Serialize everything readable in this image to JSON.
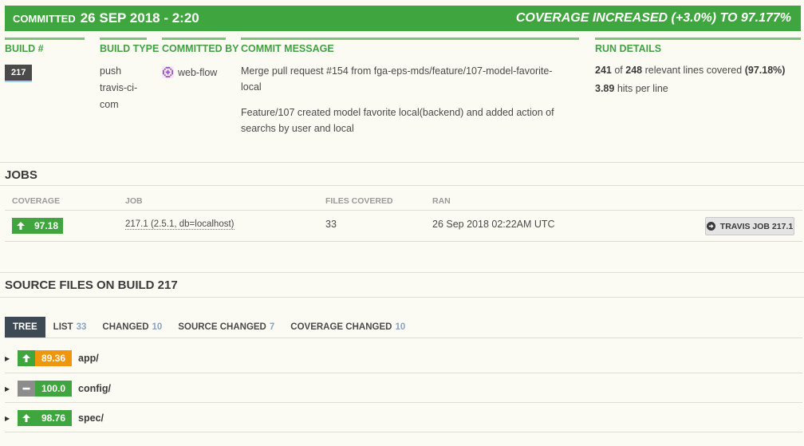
{
  "banner": {
    "committed_label": "Committed",
    "committed_date": "26 SEP 2018 - 2:20",
    "coverage_status": "COVERAGE INCREASED (+3.0%) TO 97.177%"
  },
  "info": {
    "build": {
      "heading": "BUILD #",
      "value": "217"
    },
    "build_type": {
      "heading": "BUILD TYPE",
      "lines": [
        "push",
        "travis-ci-",
        "com"
      ]
    },
    "committed_by": {
      "heading": "COMMITTED BY",
      "user": "web-flow"
    },
    "commit_message": {
      "heading": "COMMIT MESSAGE",
      "paragraph1": "Merge pull request #154 from fga-eps-mds/feature/107-model-favorite-local",
      "paragraph2": "Feature/107 created model favorite local(backend) and added action of searchs by user and local"
    },
    "run_details": {
      "heading": "RUN DETAILS",
      "covered": "241",
      "of": "of",
      "relevant": "248",
      "relevant_text": "relevant lines covered",
      "percent": "(97.18%)",
      "hits": "3.89",
      "hits_text": "hits per line"
    }
  },
  "jobs": {
    "title": "JOBS",
    "headers": {
      "coverage": "Coverage",
      "job": "Job",
      "files_covered": "Files Covered",
      "ran": "Ran"
    },
    "rows": [
      {
        "coverage": "97.18",
        "job": "217.1 (2.5.1, db=localhost)",
        "files_covered": "33",
        "ran": "26 Sep 2018 02:22AM UTC",
        "button": "TRAVIS JOB 217.1"
      }
    ]
  },
  "source_files": {
    "title": "SOURCE FILES ON BUILD 217",
    "tabs": [
      {
        "label": "TREE",
        "count": ""
      },
      {
        "label": "LIST",
        "count": "33"
      },
      {
        "label": "CHANGED",
        "count": "10"
      },
      {
        "label": "SOURCE CHANGED",
        "count": "7"
      },
      {
        "label": "COVERAGE CHANGED",
        "count": "10"
      }
    ],
    "tree": [
      {
        "coverage": "89.36",
        "name": "app/",
        "trend": "up",
        "color": "#f0960c"
      },
      {
        "coverage": "100.0",
        "name": "config/",
        "trend": "flat",
        "color": "#3fa63f"
      },
      {
        "coverage": "98.76",
        "name": "spec/",
        "trend": "up",
        "color": "#3fa63f"
      }
    ]
  },
  "colors": {
    "accent_green": "#3fa63f",
    "orange": "#f0960c",
    "gray_flat": "#8c8c8c",
    "tab_active": "#3d4a55"
  }
}
